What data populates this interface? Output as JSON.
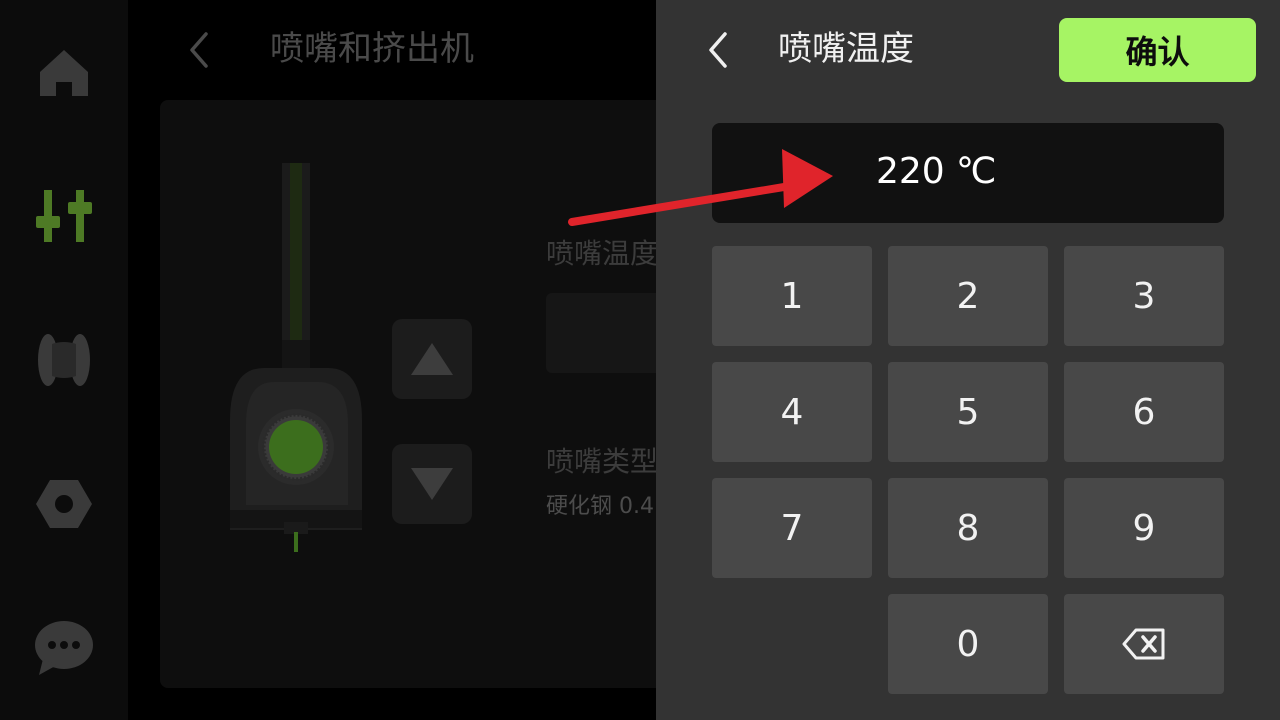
{
  "background_screen": {
    "title": "喷嘴和挤出机",
    "nozzle_temp_label": "喷嘴温度",
    "nozzle_type_label": "喷嘴类型",
    "nozzle_type_value": "硬化钢 0.4"
  },
  "sidebar": {
    "items": [
      {
        "icon": "home-icon"
      },
      {
        "icon": "sliders-icon",
        "active": true
      },
      {
        "icon": "filament-icon"
      },
      {
        "icon": "nut-icon"
      },
      {
        "icon": "chat-icon"
      }
    ],
    "active_color": "#5c8a2a"
  },
  "keypad_panel": {
    "title": "喷嘴温度",
    "confirm_label": "确认",
    "display": {
      "value": "220",
      "unit": "℃"
    },
    "keys": [
      "1",
      "2",
      "3",
      "4",
      "5",
      "6",
      "7",
      "8",
      "9",
      "0"
    ],
    "backspace_icon": "backspace-icon"
  },
  "colors": {
    "confirm_bg": "#a6f464",
    "panel_bg": "#333333",
    "key_bg": "#484848",
    "annotation_arrow": "#e0242b"
  }
}
